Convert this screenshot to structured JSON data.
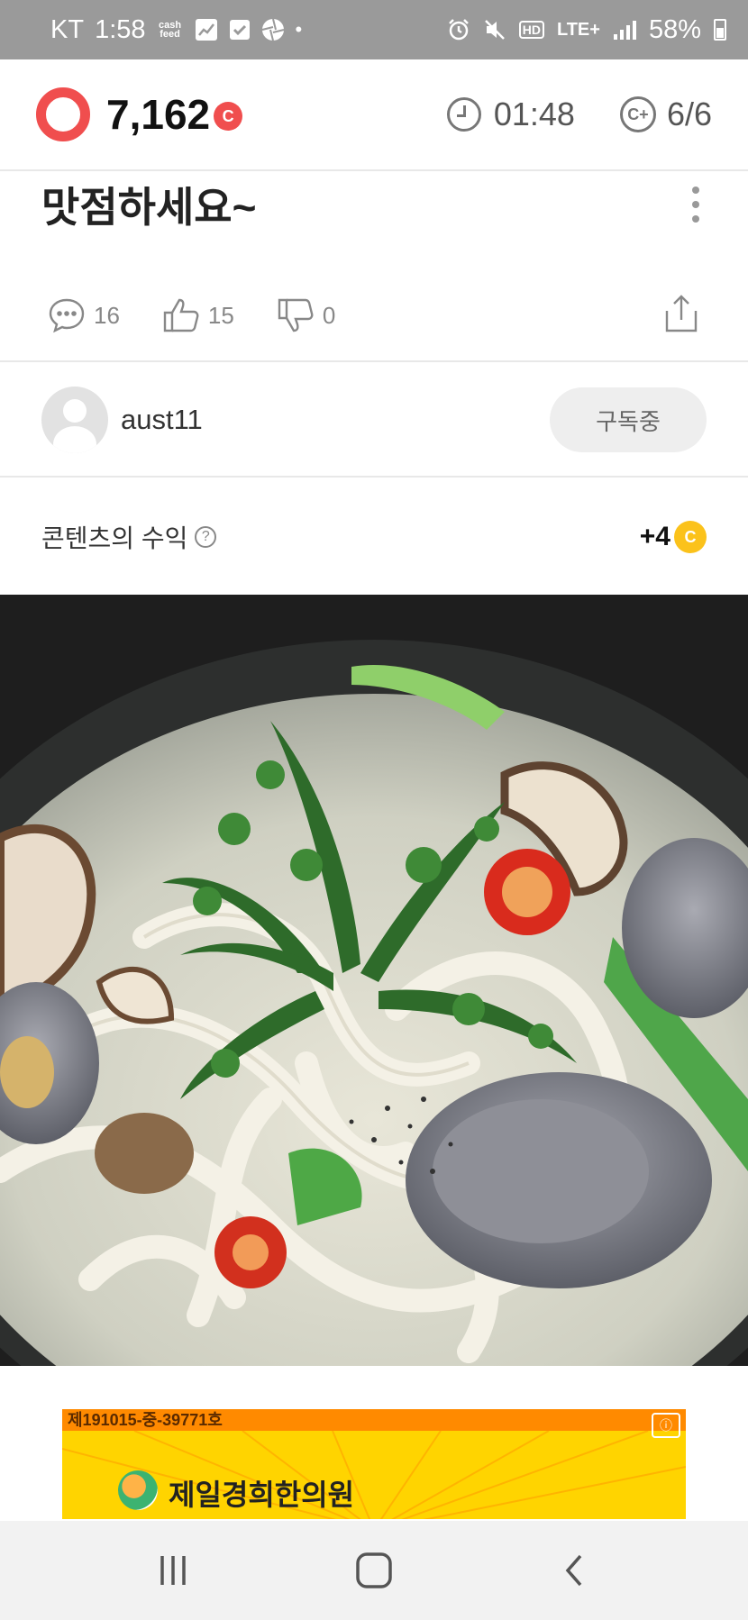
{
  "status_bar": {
    "carrier": "KT",
    "time": "1:58",
    "cashfeed": "cash feed",
    "network": "LTE+",
    "hd": "HD",
    "battery": "58%"
  },
  "header": {
    "points": "7,162",
    "coin_symbol": "C",
    "timer": "01:48",
    "counter": "6/6"
  },
  "post": {
    "title": "맛점하세요~",
    "comments": "16",
    "likes": "15",
    "dislikes": "0"
  },
  "author": {
    "name": "aust11",
    "subscribe_label": "구독중"
  },
  "earnings": {
    "label": "콘텐츠의 수익",
    "help": "?",
    "value": "+4",
    "coin_symbol": "C"
  },
  "ad": {
    "top_text": "제191015-중-39771호",
    "brand_text": "제일경희한의원"
  },
  "colors": {
    "accent_red": "#f04e4e",
    "coin_yellow": "#fbc21b",
    "ad_yellow": "#ffd400",
    "ad_orange": "#ff8a00"
  }
}
